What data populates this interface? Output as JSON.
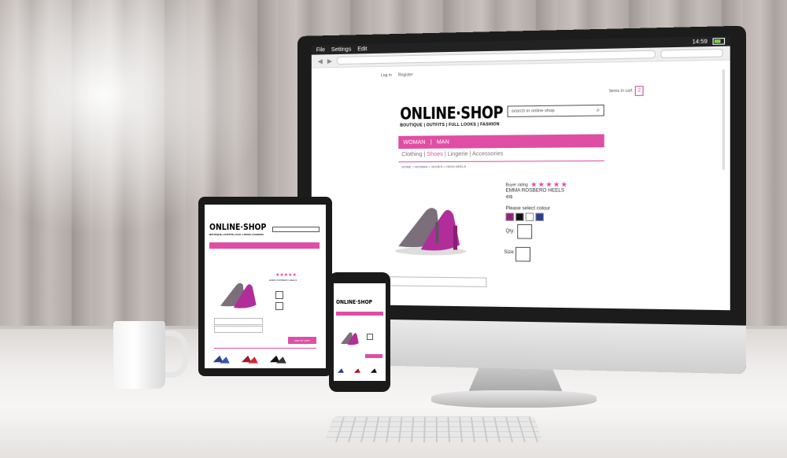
{
  "system_bar": {
    "menu": [
      "File",
      "Settings",
      "Edit"
    ],
    "time": "14:59"
  },
  "site": {
    "top_links": [
      "Log in",
      "Register"
    ],
    "cart_label": "Items in cart",
    "cart_count": "2",
    "logo": "ONLINE·SHOP",
    "tagline": "BOUTIQUE | OUTFITS | FULL LOOKS | FASHION",
    "search_placeholder": "search in online shop",
    "main_nav": [
      "WOMAN",
      "MAN"
    ],
    "sub_nav": [
      "Clothing",
      "Shoes",
      "Lingerie",
      "Accessories"
    ],
    "breadcrumb": "HOME > WOMAN > SHOES > HIGH HEELS",
    "product": {
      "rating_label": "Buyer rating",
      "stars": "★★★★★",
      "name": "EMMA ROSBERO HEELS",
      "price": "49$",
      "colour_label": "Please select colour",
      "colours": [
        "#9a1f7a",
        "#111111",
        "#ffffff",
        "#2a3e8c"
      ],
      "qty_label": "Qty:",
      "size_label": "Size:"
    },
    "tablet_button": "ADD TO CART"
  },
  "colors": {
    "accent": "#df4ea4"
  }
}
